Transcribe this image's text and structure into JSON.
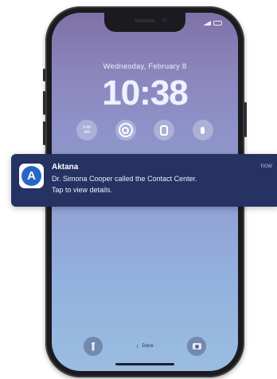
{
  "lock_screen": {
    "date": "Wednesday, February 8",
    "time": "10:38",
    "widgets": [
      {
        "icon": "clock-widget-icon",
        "time": "9:40",
        "period": "AM"
      },
      {
        "icon": "activity-rings-icon"
      },
      {
        "icon": "watch-icon"
      },
      {
        "icon": "microphone-icon"
      }
    ],
    "focus_label": "Done",
    "bottom_left_icon": "flashlight-icon",
    "bottom_right_icon": "camera-icon"
  },
  "notification": {
    "app_name": "Aktana",
    "app_icon_letter": "A",
    "message_line1": "Dr. Simona Cooper called the Contact Center.",
    "message_line2": "Tap to view details.",
    "timestamp": "now",
    "colors": {
      "background": "#253262",
      "icon_accent": "#2866c4"
    }
  }
}
